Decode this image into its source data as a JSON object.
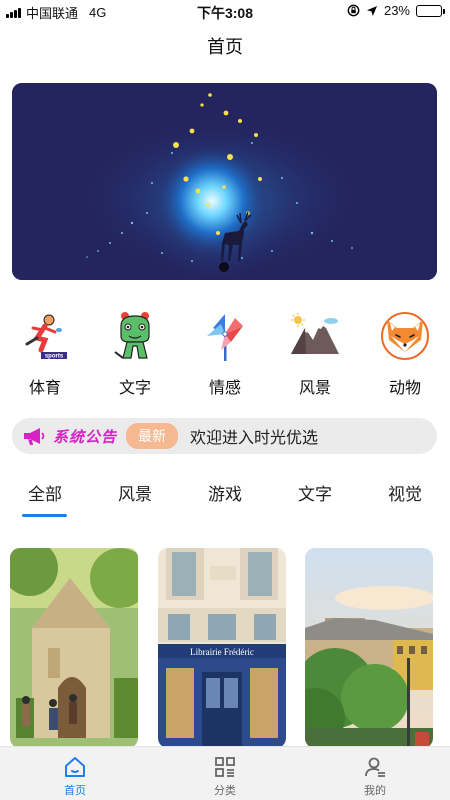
{
  "status_bar": {
    "carrier": "中国联通",
    "network": "4G",
    "time": "下午3:08",
    "battery": "23%",
    "battery_level": 0.23
  },
  "nav": {
    "title": "首页"
  },
  "categories": [
    {
      "label": "体育",
      "icon": "sports-icon"
    },
    {
      "label": "文字",
      "icon": "dinosaur-icon"
    },
    {
      "label": "情感",
      "icon": "pinwheel-icon"
    },
    {
      "label": "风景",
      "icon": "mountain-icon"
    },
    {
      "label": "动物",
      "icon": "fox-icon"
    }
  ],
  "notice": {
    "tag": "系统公告",
    "badge": "最新",
    "message": "欢迎进入时光优选"
  },
  "tabs": [
    {
      "label": "全部",
      "active": true
    },
    {
      "label": "风景",
      "active": false
    },
    {
      "label": "游戏",
      "active": false
    },
    {
      "label": "文字",
      "active": false
    },
    {
      "label": "视觉",
      "active": false
    }
  ],
  "cards": [
    {
      "sign": ""
    },
    {
      "sign": "Librairie Frédéric"
    },
    {
      "sign": ""
    }
  ],
  "tabbar": [
    {
      "label": "首页",
      "icon": "home-icon",
      "active": true
    },
    {
      "label": "分类",
      "icon": "grid-icon",
      "active": false
    },
    {
      "label": "我的",
      "icon": "user-icon",
      "active": false
    }
  ],
  "colors": {
    "accent": "#1e7ef0",
    "notice_tag": "#d722c4",
    "badge_bg": "#f6b891",
    "banner_bg": "#24245e"
  }
}
